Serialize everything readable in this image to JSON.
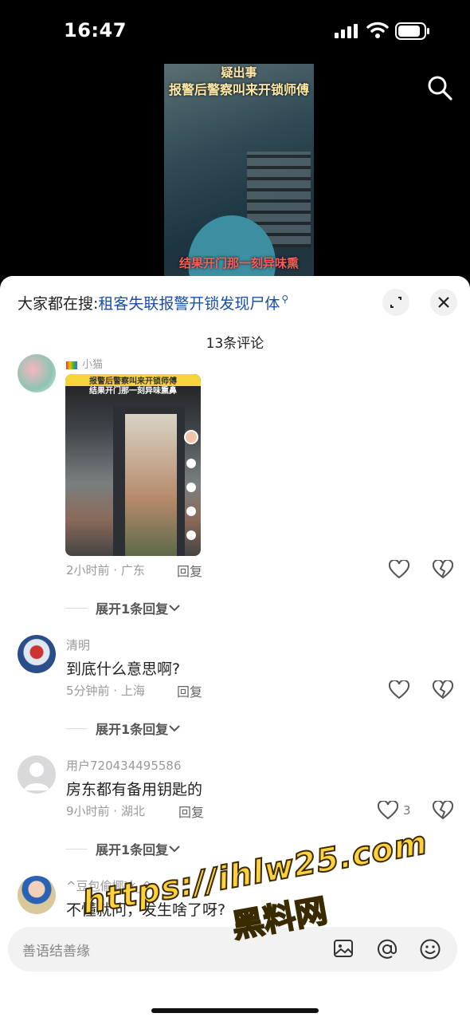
{
  "status_bar": {
    "time": "16:47"
  },
  "video": {
    "caption_top": "疑出事",
    "caption_main": "报警后警察叫来开锁师傅",
    "caption_bottom": "结果开门那一刻异味熏"
  },
  "header": {
    "hot_prefix": "大家都在搜:",
    "hot_query": "租客失联报警开锁发现尸体",
    "count": "13条评论"
  },
  "comments": [
    {
      "username": "小猫",
      "image_caption_1": "报警后警察叫来开锁师傅",
      "image_caption_2": "结果开门那一刻异味熏鼻",
      "meta": "2小时前 · 广东",
      "reply_label": "回复",
      "likes": "",
      "more_label": "展开1条回复"
    },
    {
      "username": "清明",
      "text": "到底什么意思啊?",
      "meta": "5分钟前 · 上海",
      "reply_label": "回复",
      "likes": "",
      "more_label": "展开1条回复"
    },
    {
      "username": "用户720434495586",
      "text": "房东都有备用钥匙的",
      "meta": "9小时前 · 湖北",
      "reply_label": "回复",
      "likes": "3",
      "more_label": "展开1条回复"
    },
    {
      "username": "^豆包偷椰冰_^",
      "text": "不懂就问，发生啥了呀?"
    }
  ],
  "input": {
    "placeholder": "善语结善缘"
  },
  "watermark": {
    "url": "https://ihlw25.com",
    "name": "黑料网"
  }
}
